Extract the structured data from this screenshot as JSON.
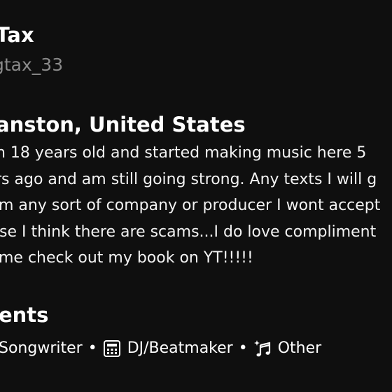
{
  "profile": {
    "name": "Tax",
    "handle": "gtax_33",
    "location": "anston, United States",
    "bio_lines": [
      "n 18 years old and started making music here 5",
      "rs ago and am still going strong. Any texts I will g",
      "m any sort of company or producer I wont accept",
      "se I think there are scams...I do love compliment",
      "me check out my book on YT!!!!!"
    ]
  },
  "talents": {
    "heading": "lents",
    "items": [
      {
        "label": "Songwriter",
        "icon": "songwriter-icon"
      },
      {
        "label": "DJ/Beatmaker",
        "icon": "drum-machine-icon"
      },
      {
        "label": "Other",
        "icon": "sparkle-music-note-icon"
      }
    ],
    "separator": "•"
  },
  "colors": {
    "background": "#0f0f0f",
    "text": "#ffffff",
    "muted": "#8a8a8a"
  }
}
